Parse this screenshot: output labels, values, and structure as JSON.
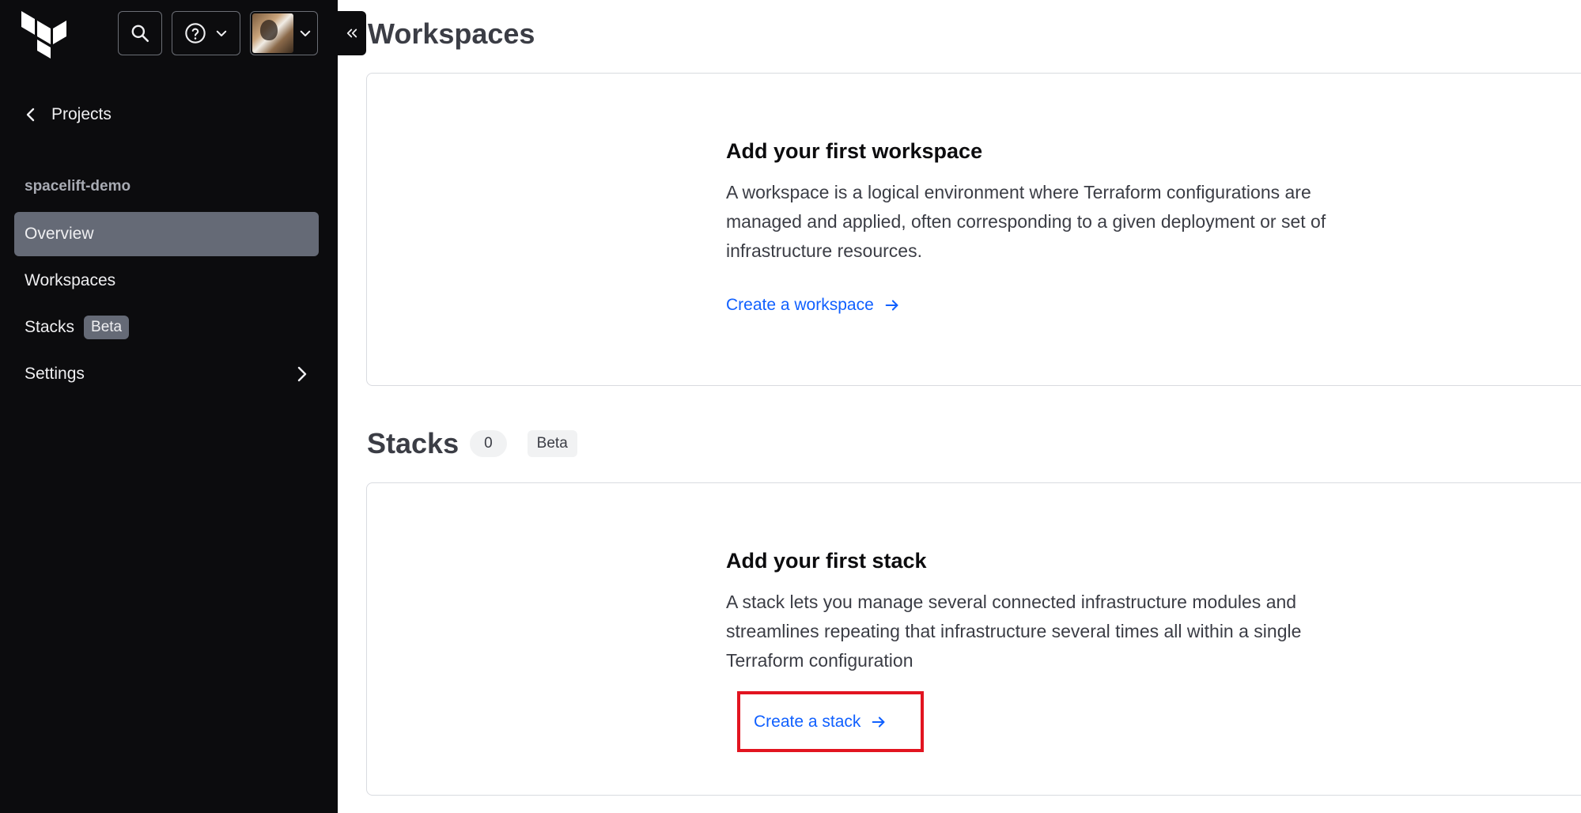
{
  "sidebar": {
    "back_label": "Projects",
    "org_name": "spacelift-demo",
    "items": [
      {
        "label": "Overview",
        "active": true
      },
      {
        "label": "Workspaces"
      },
      {
        "label": "Stacks",
        "badge": "Beta"
      },
      {
        "label": "Settings"
      }
    ]
  },
  "main": {
    "title": "Workspaces",
    "workspace_card": {
      "title": "Add your first workspace",
      "body": "A workspace is a logical environment where Terraform configurations are managed and applied, often corresponding to a given deployment or set of infrastructure resources.",
      "link": "Create a workspace"
    },
    "stacks_section": {
      "title": "Stacks",
      "count": "0",
      "badge": "Beta"
    },
    "stack_card": {
      "title": "Add your first stack",
      "body": "A stack lets you manage several connected infrastructure modules and streamlines repeating that infrastructure several times all within a single Terraform configuration",
      "link": "Create a stack"
    }
  },
  "colors": {
    "sidebar_bg": "#0c0c0e",
    "active_item_bg": "#656a76",
    "link": "#1060ff",
    "highlight": "#e21420"
  }
}
